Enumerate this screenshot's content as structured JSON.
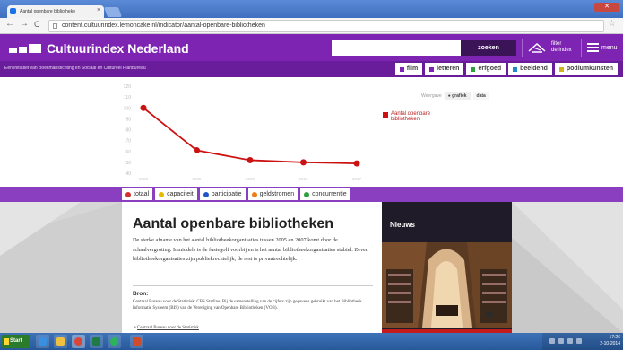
{
  "browser": {
    "tab_title": "Aantal openbare bibliotheke",
    "tab_close": "×",
    "url": "content.cultuurindex.lemoncake.nl/indicator/aantal-openbare-bibliotheken",
    "back": "←",
    "forward": "→",
    "reload": "C",
    "star": "☆"
  },
  "header": {
    "site_title": "Cultuurindex Nederland",
    "search_placeholder": "",
    "search_button": "zoeken",
    "filter_label_1": "filter",
    "filter_label_2": "de index",
    "menu_label": "menu"
  },
  "subheader": {
    "tagline": "Een initiatief van Boekmanstichting en Sociaal en Cultureel Planbureau",
    "categories": [
      {
        "label": "film",
        "color": "#7e24b2"
      },
      {
        "label": "letteren",
        "color": "#7e24b2"
      },
      {
        "label": "erfgoed",
        "color": "#2e9e3f"
      },
      {
        "label": "beeldend",
        "color": "#1f8ac8"
      },
      {
        "label": "podiumkunsten",
        "color": "#d3b21f"
      }
    ]
  },
  "view_toggle": {
    "label": "Weergave",
    "options": [
      "grafiek",
      "data"
    ],
    "selected": "grafiek"
  },
  "chart_data": {
    "type": "line",
    "x": [
      "2003",
      "2005",
      "2009",
      "2013",
      "2017"
    ],
    "series": [
      {
        "name": "Aantal openbare bibliotheken",
        "values": [
          100,
          61,
          52,
          50,
          49
        ],
        "color": "#cc1111"
      }
    ],
    "yticks": [
      40,
      50,
      60,
      70,
      80,
      90,
      100,
      110,
      120
    ],
    "ylim": [
      40,
      120
    ],
    "title": "",
    "xlabel": "",
    "ylabel": "",
    "legend": "right",
    "legend_lines": [
      "Aantal openbare",
      "bibliotheken"
    ]
  },
  "indicators": [
    {
      "label": "totaal",
      "color": "#d32f2f"
    },
    {
      "label": "capaciteit",
      "color": "#e6b800"
    },
    {
      "label": "participatie",
      "color": "#1f55c8"
    },
    {
      "label": "geldstromen",
      "color": "#f07d1a"
    },
    {
      "label": "concurrentie",
      "color": "#2e9e3f"
    }
  ],
  "article": {
    "title": "Aantal openbare bibliotheken",
    "body": "De sterke afname van het aantal bibliotheekorganisaties tussen 2005 en 2007 komt door de schaalvergroting. Inmiddels is de fusiegolf voorbij en is het aantal bibliotheekorganisaties stabiel. Zeven bibliotheekorganisaties zijn publiekrechtelijk, de rest is privaatrechtelijk.",
    "source_heading": "Bron:",
    "source_text": "Centraal Bureau voor de Statistiek, CBS Statline. Bij de samenstelling van de cijfers zijn gegevens gebruikt van het Bibliotheek Informatie Systeem (BIS) van de Vereniging van Openbare Bibliotheken (VOB).",
    "source_link": "Centraal Bureau voor de Statistiek"
  },
  "news": {
    "heading": "Nieuws"
  },
  "taskbar": {
    "start_label": "Start",
    "clock_time": "17:26",
    "clock_date": "2-10-2014"
  }
}
